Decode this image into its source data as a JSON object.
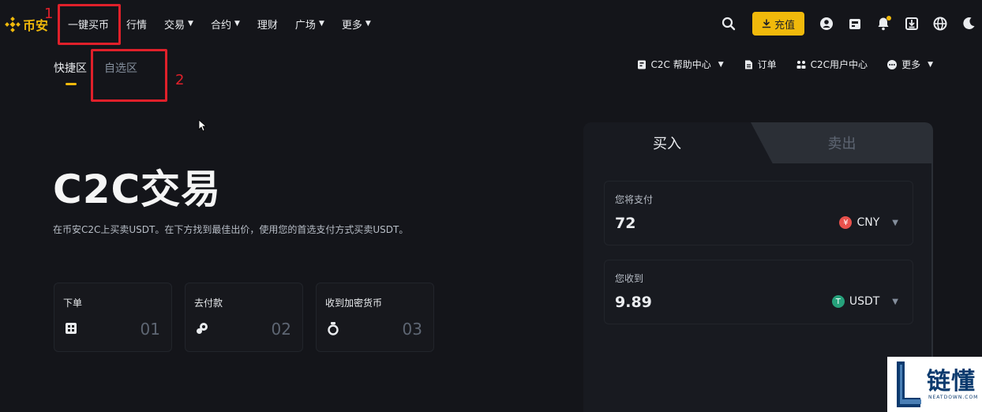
{
  "header": {
    "logo_text": "币安",
    "nav": [
      {
        "label": "一键买币",
        "dropdown": false
      },
      {
        "label": "行情",
        "dropdown": false
      },
      {
        "label": "交易",
        "dropdown": true
      },
      {
        "label": "合约",
        "dropdown": true
      },
      {
        "label": "理财",
        "dropdown": false
      },
      {
        "label": "广场",
        "dropdown": true
      },
      {
        "label": "更多",
        "dropdown": true
      }
    ],
    "deposit_label": "充值"
  },
  "annotations": {
    "box1_number": "1",
    "box2_number": "2"
  },
  "subtabs": [
    {
      "label": "快捷区",
      "active": true
    },
    {
      "label": "自选区",
      "active": false
    }
  ],
  "subnav": {
    "help": "C2C 帮助中心",
    "orders": "订单",
    "user_center": "C2C用户中心",
    "more": "更多"
  },
  "hero": {
    "title": "C2C交易",
    "subtitle": "在币安C2C上买卖USDT。在下方找到最佳出价，使用您的首选支付方式买卖USDT。"
  },
  "steps": [
    {
      "label": "下单",
      "number": "01"
    },
    {
      "label": "去付款",
      "number": "02"
    },
    {
      "label": "收到加密货币",
      "number": "03"
    }
  ],
  "trade_panel": {
    "buy_tab": "买入",
    "sell_tab": "卖出",
    "pay": {
      "label": "您将支付",
      "value": "72",
      "currency": "CNY"
    },
    "receive": {
      "label": "您收到",
      "value": "9.89",
      "currency": "USDT"
    }
  },
  "watermark": {
    "text": "链懂",
    "sub": "NEATDOWN.COM"
  },
  "colors": {
    "accent": "#f0b90b",
    "background": "#14151a",
    "annotation_red": "#e0202a",
    "cny_coin": "#e8514c",
    "usdt_coin": "#26a17b"
  }
}
